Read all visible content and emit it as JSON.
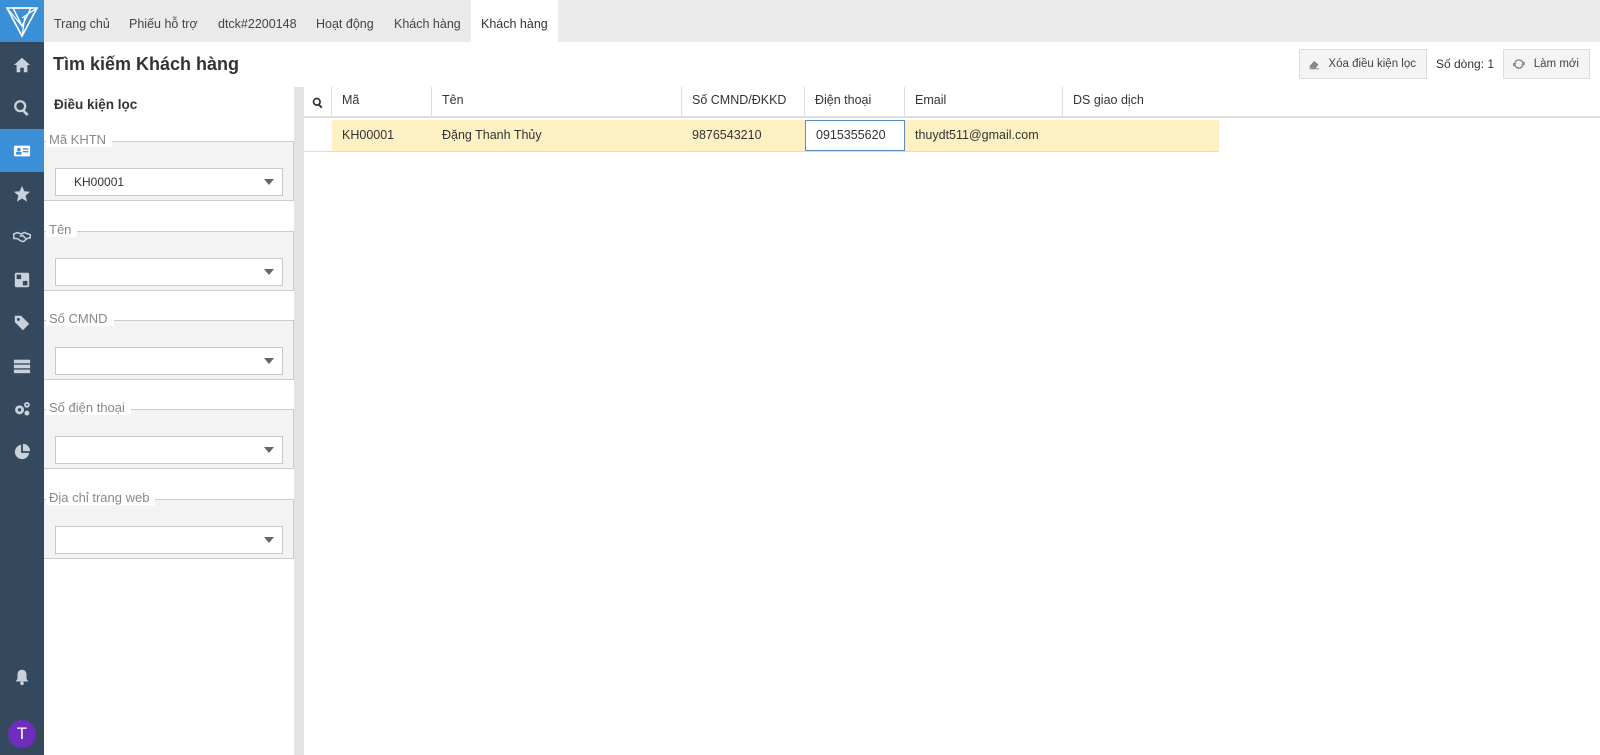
{
  "tabs": [
    {
      "label": "Trang chủ"
    },
    {
      "label": "Phiếu hỗ trợ"
    },
    {
      "label": "dtck#2200148"
    },
    {
      "label": "Hoạt động"
    },
    {
      "label": "Khách hàng"
    },
    {
      "label": "Khách hàng",
      "active": true
    }
  ],
  "rail": {
    "items": [
      "home-icon",
      "search-icon",
      "contact-card-icon",
      "star-icon",
      "handshake-icon",
      "dashboard-icon",
      "tag-icon",
      "server-icon",
      "gears-icon",
      "pie-chart-icon"
    ],
    "active": "contact-card-icon",
    "avatar_letter": "T",
    "avatar_color": "#6f2dbd",
    "accent": "#3a8fd6"
  },
  "header": {
    "title": "Tìm kiếm Khách hàng",
    "clear_filter_label": "Xóa điều kiện lọc",
    "row_count_label": "Số dòng: 1",
    "refresh_label": "Làm mới"
  },
  "filter": {
    "title": "Điều kiện lọc",
    "fields": [
      {
        "label": "Mã KHTN",
        "value": "KH00001"
      },
      {
        "label": "Tên",
        "value": ""
      },
      {
        "label": "Số CMND",
        "value": ""
      },
      {
        "label": "Số điện thoại",
        "value": ""
      },
      {
        "label": "Địa chỉ trang web",
        "value": ""
      }
    ]
  },
  "grid": {
    "columns": [
      "Mã",
      "Tên",
      "Số CMND/ĐKKD",
      "Điện thoại",
      "Email",
      "DS giao dịch"
    ],
    "rows": [
      {
        "ma": "KH00001",
        "ten": "Đặng Thanh Thủy",
        "cmnd": "9876543210",
        "dien_thoai": "0915355620",
        "email": "thuydt511@gmail.com",
        "ds_giao_dich": ""
      }
    ],
    "selected_row_color": "#fdf1c3"
  }
}
